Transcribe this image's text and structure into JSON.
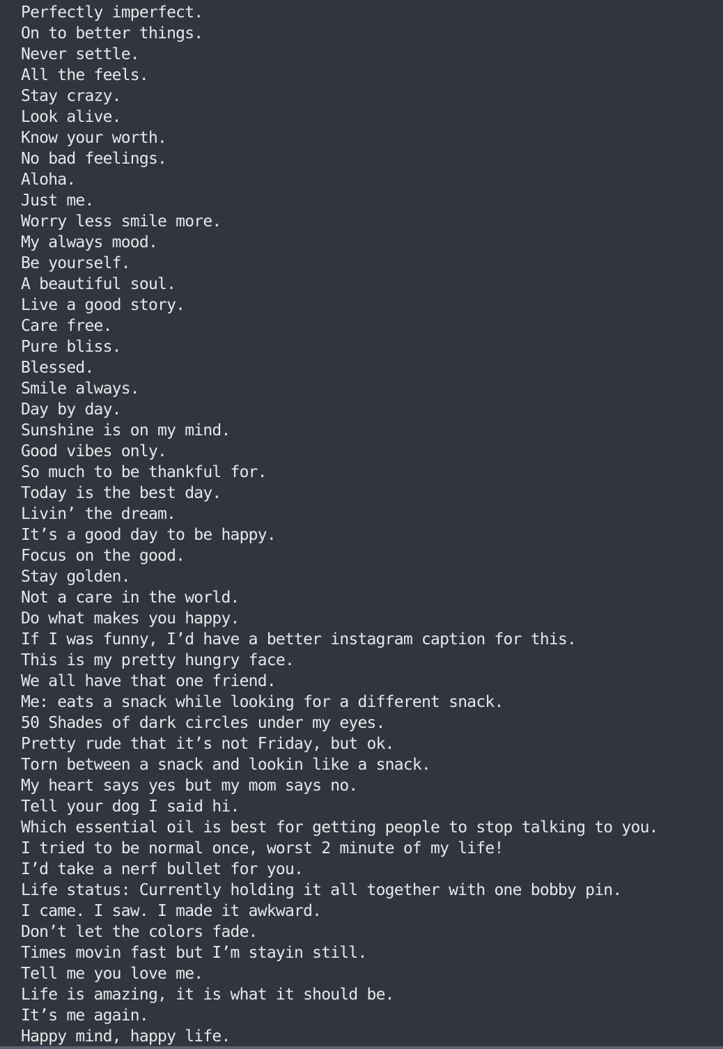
{
  "terminal": {
    "lines": [
      "Perfectly imperfect.",
      "On to better things.",
      "Never settle.",
      "All the feels.",
      "Stay crazy.",
      "Look alive.",
      "Know your worth.",
      "No bad feelings.",
      "Aloha.",
      "Just me.",
      "Worry less smile more.",
      "My always mood.",
      "Be yourself.",
      "A beautiful soul.",
      "Live a good story.",
      "Care free.",
      "Pure bliss.",
      "Blessed.",
      "Smile always.",
      "Day by day.",
      "Sunshine is on my mind.",
      "Good vibes only.",
      "So much to be thankful for.",
      "Today is the best day.",
      "Livin’ the dream.",
      "It’s a good day to be happy.",
      "Focus on the good.",
      "Stay golden.",
      "Not a care in the world.",
      "Do what makes you happy.",
      "If I was funny, I’d have a better instagram caption for this.",
      "This is my pretty hungry face.",
      "We all have that one friend.",
      "Me: eats a snack while looking for a different snack.",
      "50 Shades of dark circles under my eyes.",
      "Pretty rude that it’s not Friday, but ok.",
      "Torn between a snack and lookin like a snack.",
      "My heart says yes but my mom says no.",
      "Tell your dog I said hi.",
      "Which essential oil is best for getting people to stop talking to you.",
      "I tried to be normal once, worst 2 minute of my life!",
      "I’d take a nerf bullet for you.",
      "Life status: Currently holding it all together with one bobby pin.",
      "I came. I saw. I made it awkward.",
      "Don’t let the colors fade.",
      "Times movin fast but I’m stayin still.",
      "Tell me you love me.",
      "Life is amazing, it is what it should be.",
      "It’s me again.",
      "Happy mind, happy life."
    ]
  }
}
